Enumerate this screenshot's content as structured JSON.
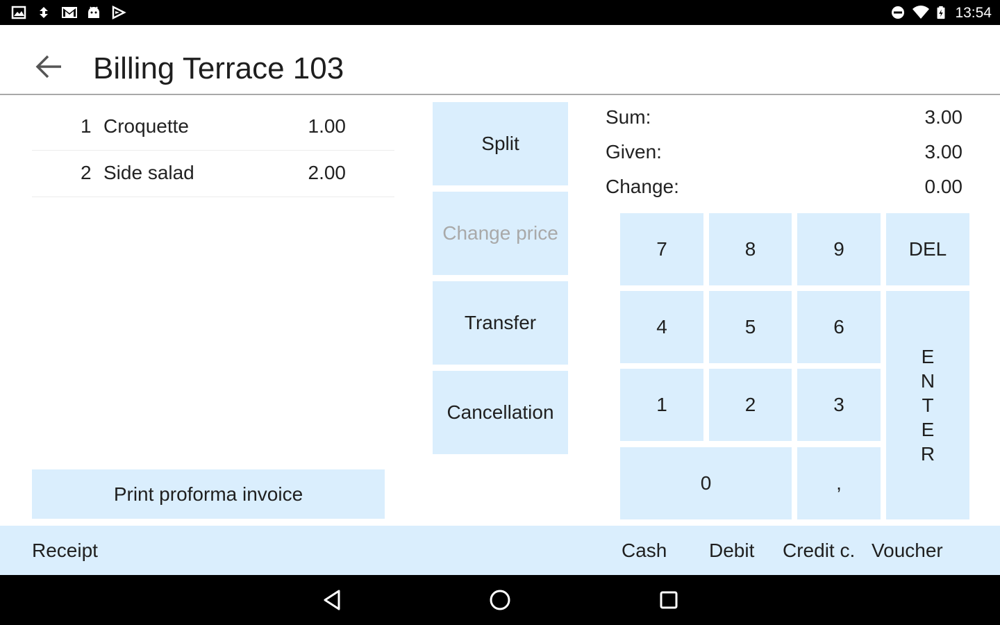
{
  "status_bar": {
    "time": "13:54",
    "left_icons": [
      "image-icon",
      "sync-icon",
      "gmail-icon",
      "android-icon",
      "play-store-icon"
    ],
    "right_icons": [
      "do-not-disturb-icon",
      "wifi-icon",
      "battery-icon"
    ]
  },
  "app_bar": {
    "title": "Billing Terrace 103",
    "back_icon": "arrow-left-icon"
  },
  "order": {
    "items": [
      {
        "qty": "1",
        "name": "Croquette",
        "price": "1.00"
      },
      {
        "qty": "2",
        "name": "Side salad",
        "price": "2.00"
      }
    ],
    "print_label": "Print proforma invoice"
  },
  "actions": {
    "split": "Split",
    "change_price": "Change price",
    "transfer": "Transfer",
    "cancellation": "Cancellation"
  },
  "totals": {
    "sum_label": "Sum:",
    "sum_value": "3.00",
    "given_label": "Given:",
    "given_value": "3.00",
    "change_label": "Change:",
    "change_value": "0.00"
  },
  "keypad": {
    "k7": "7",
    "k8": "8",
    "k9": "9",
    "del": "DEL",
    "k4": "4",
    "k5": "5",
    "k6": "6",
    "k1": "1",
    "k2": "2",
    "k3": "3",
    "k0": "0",
    "comma": ",",
    "enter": [
      "E",
      "N",
      "T",
      "E",
      "R"
    ]
  },
  "payment_bar": {
    "receipt": "Receipt",
    "cash": "Cash",
    "debit": "Debit",
    "credit": "Credit c.",
    "voucher": "Voucher"
  },
  "nav_bar": {
    "icons": [
      "back-triangle-icon",
      "home-circle-icon",
      "recents-square-icon"
    ]
  },
  "colors": {
    "button_bg": "#daeefd",
    "disabled_text": "#a9a9a9",
    "divider": "#a8a8a8"
  }
}
